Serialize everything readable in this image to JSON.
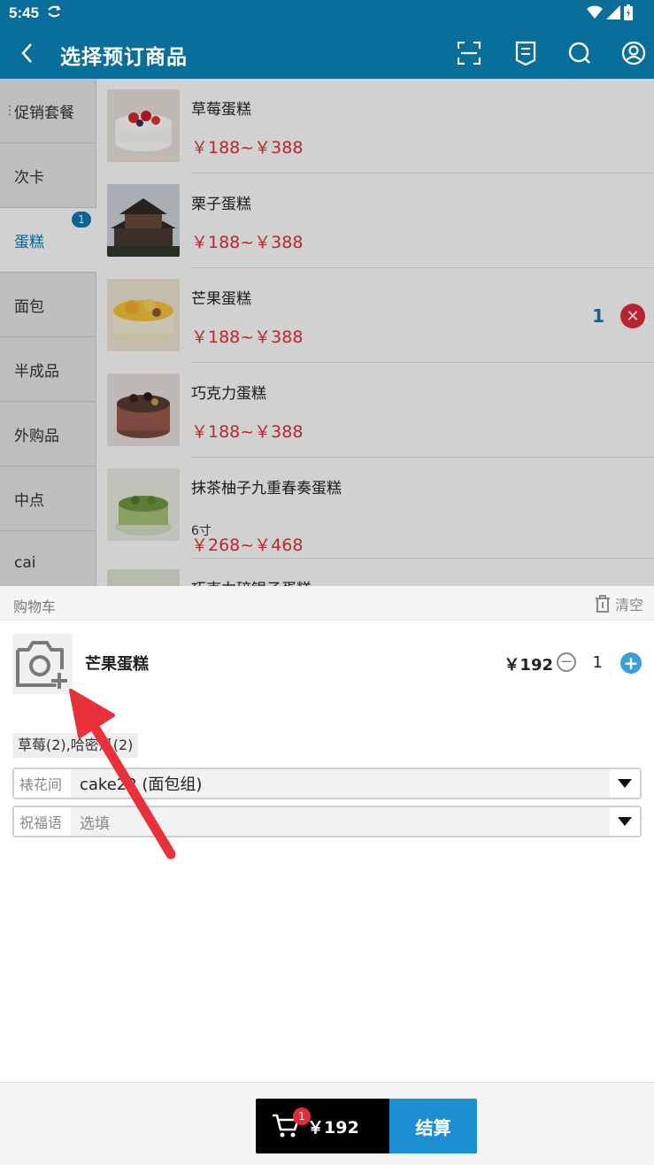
{
  "status_bar": {
    "time": "5:45"
  },
  "app_bar": {
    "title": "选择预订商品"
  },
  "sidebar": {
    "items": [
      {
        "label": "促销套餐"
      },
      {
        "label": "次卡"
      },
      {
        "label": "蛋糕",
        "badge": "1"
      },
      {
        "label": "面包"
      },
      {
        "label": "半成品"
      },
      {
        "label": "外购品"
      },
      {
        "label": "中点"
      },
      {
        "label": "cai"
      }
    ]
  },
  "products": [
    {
      "name": "草莓蛋糕",
      "price": "￥188~￥388"
    },
    {
      "name": "栗子蛋糕",
      "price": "￥188~￥388"
    },
    {
      "name": "芒果蛋糕",
      "price": "￥188~￥388",
      "qty": "1"
    },
    {
      "name": "巧克力蛋糕",
      "price": "￥188~￥388"
    },
    {
      "name": "抹茶柚子九重春奏蛋糕",
      "spec": "6寸",
      "price": "￥268~￥468"
    },
    {
      "name": "巧克力碎银子蛋糕"
    }
  ],
  "cart": {
    "title": "购物车",
    "clear_label": "清空",
    "item": {
      "name": "芒果蛋糕",
      "price": "￥192",
      "qty": "1",
      "tags": "草莓(2),哈密瓜(2)",
      "field1_label": "裱花间",
      "field1_value": "cake22 (面包组)",
      "field2_label": "祝福语",
      "field2_placeholder": "选填"
    }
  },
  "checkout": {
    "badge": "1",
    "total": "￥192",
    "button_label": "结算"
  },
  "colors": {
    "primary": "#0a6e9b",
    "accent": "#1c8fd3",
    "price": "#e0313a"
  }
}
